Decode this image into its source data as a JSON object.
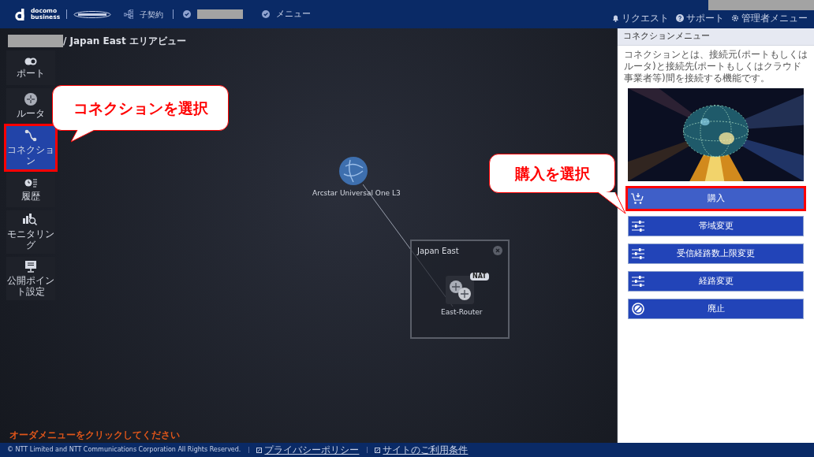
{
  "header": {
    "brand_top": "docomo",
    "brand_bottom": "business",
    "contract": "子契約",
    "menu": "メニュー",
    "links": [
      {
        "kind": "request",
        "label": "リクエスト"
      },
      {
        "kind": "support",
        "label": "サポート"
      },
      {
        "kind": "admin",
        "label": "管理者メニュー"
      }
    ]
  },
  "breadcrumb": "/ Japan East エリアビュー",
  "sidebar": [
    {
      "kind": "port",
      "label": "ポート",
      "selected": false
    },
    {
      "kind": "router",
      "label": "ルータ",
      "selected": false
    },
    {
      "kind": "connection",
      "label": "コネクション",
      "selected": true
    },
    {
      "kind": "history",
      "label": "履歴",
      "selected": false
    },
    {
      "kind": "monitoring",
      "label": "モニタリング",
      "selected": false
    },
    {
      "kind": "public",
      "label": "公開ポイント設定",
      "selected": false
    }
  ],
  "canvas": {
    "cloud_node": "Arcstar Universal One L3",
    "area": {
      "title": "Japan East",
      "router": {
        "label": "East-Router",
        "badge": "NAT"
      }
    }
  },
  "callouts": [
    "コネクションを選択",
    "購入を選択"
  ],
  "hint": "オーダメニューをクリックしてください",
  "panel": {
    "title": "コネクションメニュー",
    "description": "コネクションとは、接続元(ポートもしくはルータ)と接続先(ポートもしくはクラウド事業者等)間を接続する機能です。",
    "actions": [
      {
        "kind": "purchase",
        "label": "購入",
        "selected": true
      },
      {
        "kind": "adjust",
        "label": "帯域変更",
        "selected": false
      },
      {
        "kind": "adjust",
        "label": "受信経路数上限変更",
        "selected": false
      },
      {
        "kind": "adjust",
        "label": "経路変更",
        "selected": false
      },
      {
        "kind": "cancel",
        "label": "廃止",
        "selected": false
      }
    ]
  },
  "footer": {
    "copyright": "© NTT Limited and NTT Communications Corporation All Rights Reserved.",
    "links": [
      "プライバシーポリシー",
      "サイトのご利用条件"
    ]
  }
}
